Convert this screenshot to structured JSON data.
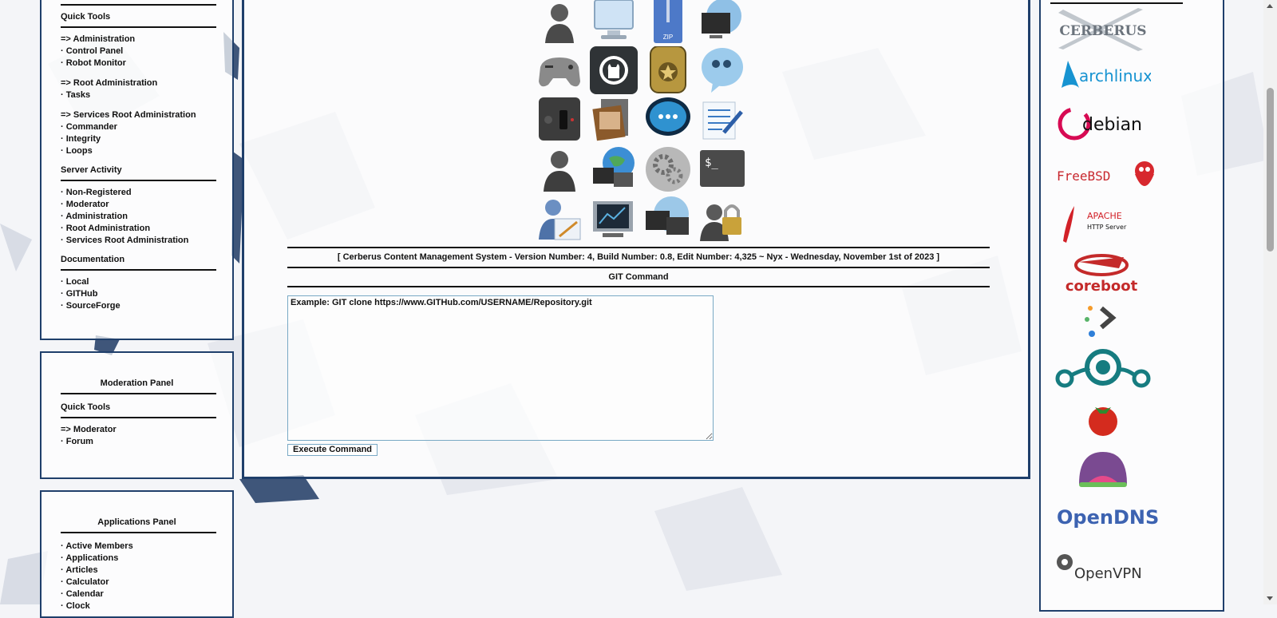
{
  "admin_panel": {
    "quick_tools_title": "Quick Tools",
    "groups": [
      {
        "items": [
          {
            "prefix": "=>",
            "label": "Administration"
          },
          {
            "prefix": "·",
            "label": "Control Panel"
          },
          {
            "prefix": "·",
            "label": "Robot Monitor"
          }
        ]
      },
      {
        "items": [
          {
            "prefix": "=>",
            "label": "Root Administration"
          },
          {
            "prefix": "·",
            "label": "Tasks"
          }
        ]
      },
      {
        "items": [
          {
            "prefix": "=>",
            "label": "Services Root Administration"
          },
          {
            "prefix": "·",
            "label": "Commander"
          },
          {
            "prefix": "·",
            "label": "Integrity"
          },
          {
            "prefix": "·",
            "label": "Loops"
          }
        ]
      }
    ],
    "server_activity_title": "Server Activity",
    "server_activity": [
      "Non-Registered",
      "Moderator",
      "Administration",
      "Root Administration",
      "Services Root Administration"
    ],
    "documentation_title": "Documentation",
    "documentation": [
      "Local",
      "GITHub",
      "SourceForge"
    ]
  },
  "moderation_panel": {
    "title": "Moderation Panel",
    "quick_tools_title": "Quick Tools",
    "items": [
      {
        "prefix": "=>",
        "label": "Moderator"
      },
      {
        "prefix": "·",
        "label": "Forum"
      }
    ]
  },
  "applications_panel": {
    "title": "Applications Panel",
    "items": [
      "Active Members",
      "Applications",
      "Articles",
      "Calculator",
      "Calendar",
      "Clock"
    ]
  },
  "center": {
    "icons": [
      "user-icon",
      "monitor-icon",
      "zip-archive-icon",
      "network-computer-icon",
      "gamepad-icon",
      "github-icon",
      "security-badge-icon",
      "chat-bubble-icon",
      "power-switch-icon",
      "photos-icon",
      "messages-icon",
      "text-editor-icon",
      "user-silhouette-icon",
      "network-globe-icon",
      "gears-icon",
      "terminal-icon",
      "user-edit-icon",
      "screen-icon",
      "remote-desktop-icon",
      "user-lock-icon"
    ],
    "version_line": "[ Cerberus Content Management System - Version Number: 4, Build Number: 0.8, Edit Number: 4,325 ~ Nyx - Wednesday, November 1st of 2023 ]",
    "section_title": "GIT Command",
    "textarea_value": "Example: GIT clone https://www.GITHub.com/USERNAME/Repository.git",
    "execute_label": "Execute Command"
  },
  "right_logos": {
    "items": [
      {
        "name": "cerberus",
        "text": "CERBERUS"
      },
      {
        "name": "archlinux",
        "text": "archlinux"
      },
      {
        "name": "debian",
        "text": "debian"
      },
      {
        "name": "freebsd",
        "text": "FreeBSD"
      },
      {
        "name": "apache",
        "text": "APACHE",
        "subtext": "HTTP Server"
      },
      {
        "name": "coreboot",
        "text": "coreboot"
      },
      {
        "name": "flux",
        "text": ""
      },
      {
        "name": "lineageos",
        "text": ""
      },
      {
        "name": "tomato",
        "text": ""
      },
      {
        "name": "lotus",
        "text": ""
      },
      {
        "name": "opendns",
        "text": "OpenDNS"
      },
      {
        "name": "openvpn",
        "text": "OpenVPN"
      }
    ]
  },
  "colors": {
    "panel_border": "#1f3f6b",
    "link": "#111111",
    "textarea_border": "#79a9c5"
  }
}
